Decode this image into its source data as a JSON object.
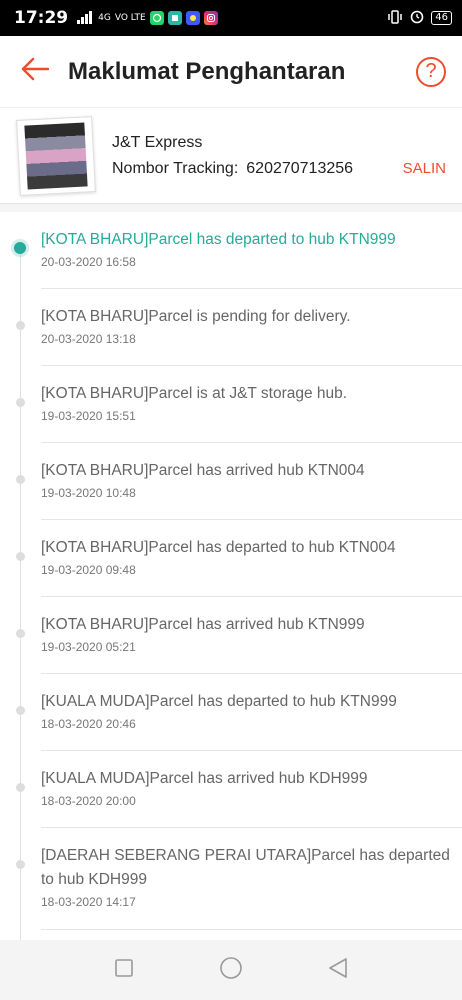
{
  "status_bar": {
    "time": "17:29",
    "network": "4G",
    "volte": "VO LTE",
    "battery": "46",
    "icons": [
      "signal-icon",
      "whatsapp-icon",
      "app-icon",
      "app-icon",
      "instagram-icon",
      "vibrate-icon",
      "alarm-icon",
      "battery-icon"
    ]
  },
  "header": {
    "title": "Maklumat Penghantaran",
    "back_icon": "arrow-left-icon",
    "help_icon": "question-icon",
    "help_label": "?"
  },
  "shipment": {
    "courier": "J&T Express",
    "tracking_label": "Nombor Tracking:",
    "tracking_number": "620270713256",
    "copy_label": "SALIN"
  },
  "events": [
    {
      "text": "[KOTA BHARU]Parcel has departed to hub KTN999",
      "time": "20-03-2020 16:58",
      "active": true
    },
    {
      "text": "[KOTA BHARU]Parcel is pending for delivery.",
      "time": "20-03-2020 13:18",
      "active": false
    },
    {
      "text": "[KOTA BHARU]Parcel is at J&T storage hub.",
      "time": "19-03-2020 15:51",
      "active": false
    },
    {
      "text": "[KOTA BHARU]Parcel has arrived hub KTN004",
      "time": "19-03-2020 10:48",
      "active": false
    },
    {
      "text": "[KOTA BHARU]Parcel has departed to hub KTN004",
      "time": "19-03-2020 09:48",
      "active": false
    },
    {
      "text": "[KOTA BHARU]Parcel has arrived hub KTN999",
      "time": "19-03-2020 05:21",
      "active": false
    },
    {
      "text": "[KUALA MUDA]Parcel has departed to hub KTN999",
      "time": "18-03-2020 20:46",
      "active": false
    },
    {
      "text": "[KUALA MUDA]Parcel has arrived hub KDH999",
      "time": "18-03-2020 20:00",
      "active": false
    },
    {
      "text": "[DAERAH SEBERANG PERAI UTARA]Parcel has departed to hub KDH999",
      "time": "18-03-2020 14:17",
      "active": false
    }
  ],
  "colors": {
    "accent": "#ee4d2d",
    "active": "#26aa99"
  },
  "nav": {
    "icons": [
      "square-icon",
      "circle-icon",
      "triangle-back-icon"
    ]
  }
}
